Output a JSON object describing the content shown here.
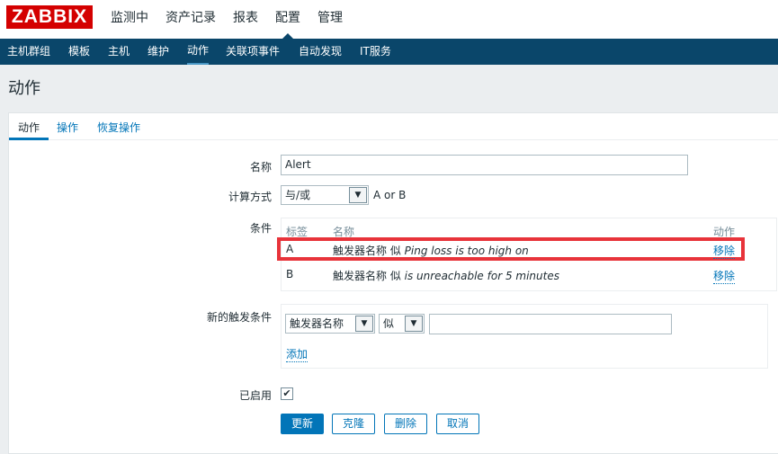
{
  "logo": "ZABBIX",
  "top_menu": [
    "监测中",
    "资产记录",
    "报表",
    "配置",
    "管理"
  ],
  "sub_menu": [
    "主机群组",
    "模板",
    "主机",
    "维护",
    "动作",
    "关联项事件",
    "自动发现",
    "IT服务"
  ],
  "page_title": "动作",
  "tabs": [
    "动作",
    "操作",
    "恢复操作"
  ],
  "form": {
    "name_label": "名称",
    "name_value": "Alert",
    "calc_label": "计算方式",
    "calc_value": "与/或",
    "calc_formula": "A or B",
    "conditions_label": "条件",
    "conditions_headers": [
      "标签",
      "名称",
      "动作"
    ],
    "conditions": [
      {
        "label": "A",
        "prefix": "触发器名称 似 ",
        "value": "Ping loss is too high on",
        "action": "移除"
      },
      {
        "label": "B",
        "prefix": "触发器名称 似 ",
        "value": "is unreachable for 5 minutes",
        "action": "移除"
      }
    ],
    "new_condition_label": "新的触发条件",
    "new_condition_type": "触发器名称",
    "new_condition_operator": "似",
    "new_condition_value": "",
    "add_link": "添加",
    "enabled_label": "已启用",
    "enabled_check": "✔"
  },
  "buttons": {
    "update": "更新",
    "clone": "克隆",
    "delete": "删除",
    "cancel": "取消"
  },
  "colors": {
    "brand": "#d40000",
    "nav": "#0a466a",
    "link": "#0275b8",
    "highlight": "#e8333a"
  }
}
